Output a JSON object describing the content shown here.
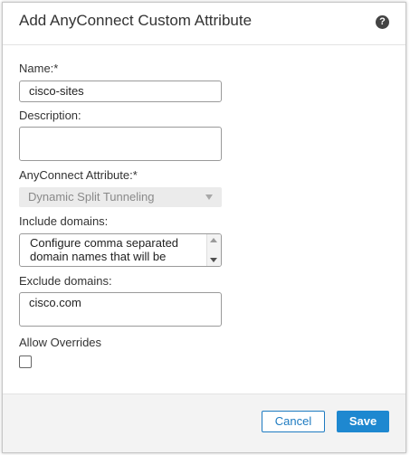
{
  "dialog": {
    "title": "Add AnyConnect Custom Attribute",
    "help_icon": "question-mark-icon"
  },
  "form": {
    "name_label": "Name:*",
    "name_value": "cisco-sites",
    "description_label": "Description:",
    "description_value": "",
    "attribute_label": "AnyConnect Attribute:*",
    "attribute_selected": "Dynamic Split Tunneling",
    "include_label": "Include domains:",
    "include_text": "Configure comma separated domain names that will be",
    "exclude_label": "Exclude domains:",
    "exclude_value": "cisco.com",
    "overrides_label": "Allow Overrides",
    "overrides_checked": false
  },
  "footer": {
    "cancel_label": "Cancel",
    "save_label": "Save"
  },
  "colors": {
    "accent": "#1e88d0",
    "disabled_bg": "#ebebeb",
    "footer_bg": "#f3f3f3"
  }
}
